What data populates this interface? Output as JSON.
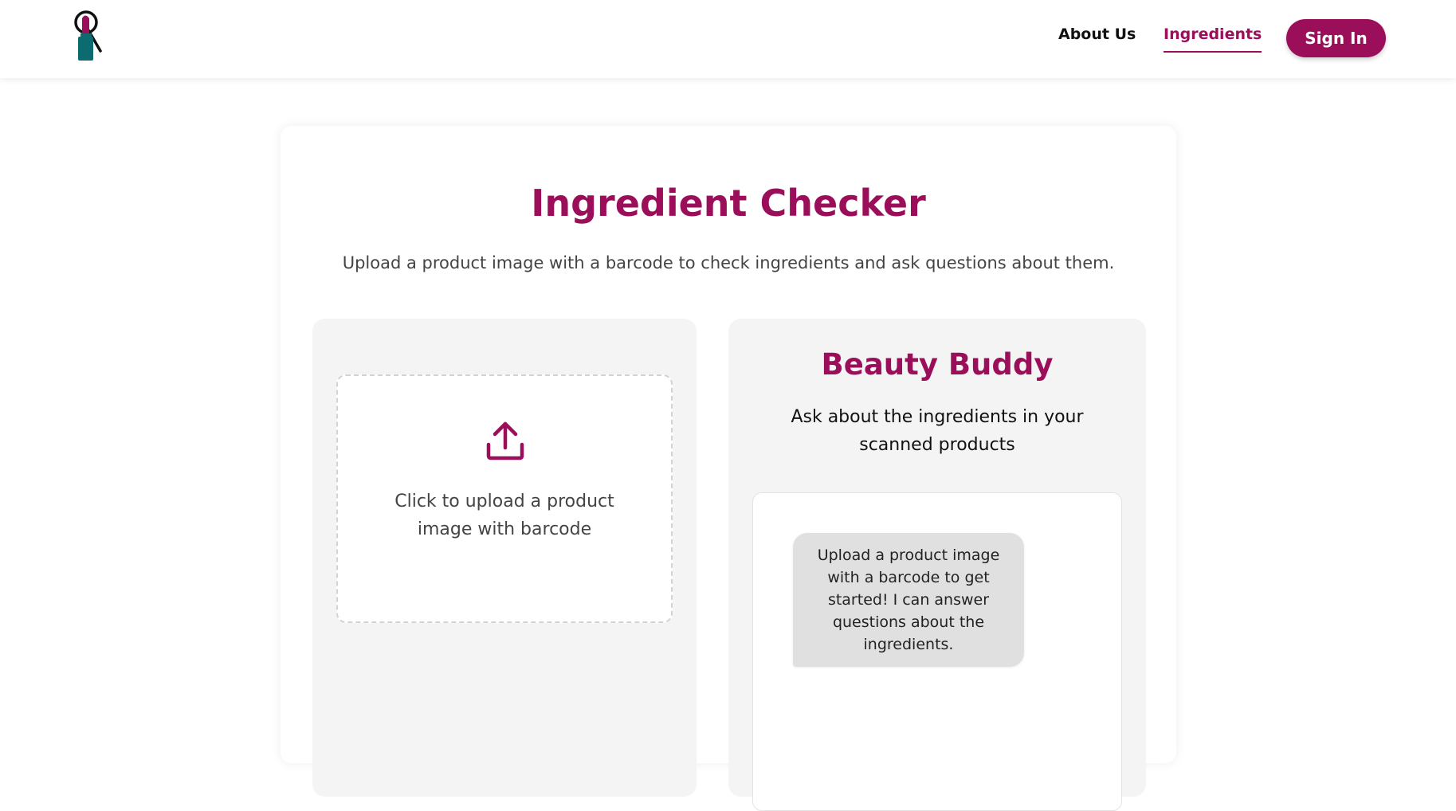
{
  "colors": {
    "brand": "#9b0e5a",
    "logo_teal": "#0b6b6e"
  },
  "header": {
    "logo_icon": "lipstick-magnifier-logo",
    "nav": [
      {
        "label": "About Us",
        "active": false
      },
      {
        "label": "Ingredients",
        "active": true
      }
    ],
    "signin_label": "Sign In"
  },
  "main": {
    "title": "Ingredient Checker",
    "subtitle": "Upload a product image with a barcode to check ingredients and ask questions about them."
  },
  "upload": {
    "icon": "upload-icon",
    "text": "Click to upload a product image with barcode"
  },
  "chat": {
    "title": "Beauty Buddy",
    "subtitle": "Ask about the ingredients in your scanned products",
    "messages": [
      {
        "from": "bot",
        "text": "Upload a product image with a barcode to get started! I can answer questions about the ingredients."
      }
    ]
  }
}
